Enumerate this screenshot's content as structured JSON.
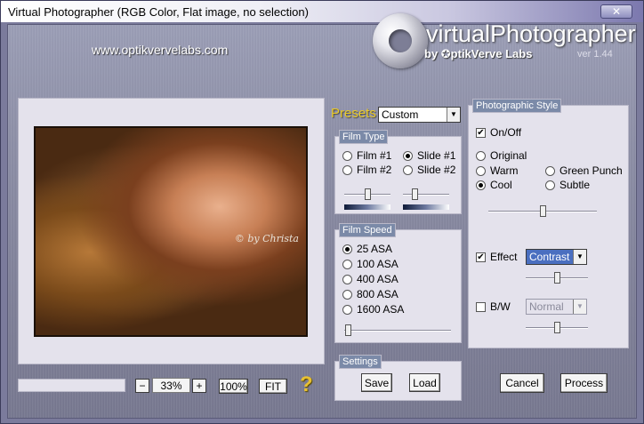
{
  "window": {
    "title": "Virtual Photographer (RGB Color, Flat image, no selection)",
    "close_glyph": "✕"
  },
  "header": {
    "url": "www.optikvervelabs.com",
    "logo_title": "virtualPhotographer",
    "logo_sub": "by ✪ptikVerve Labs",
    "version": "ver 1.44"
  },
  "preview": {
    "signature": "© by Christa"
  },
  "zoom": {
    "minus": "−",
    "value": "33%",
    "plus": "+",
    "hundred_label": "100%",
    "fit_label": "FIT",
    "help_glyph": "?"
  },
  "presets": {
    "label": "Presets",
    "selected": "Custom"
  },
  "film_type": {
    "title": "Film Type",
    "options": [
      "Film #1",
      "Slide #1",
      "Film #2",
      "Slide #2"
    ],
    "selected": "Slide #1",
    "slider_left": 0.5,
    "slider_right": 0.25
  },
  "film_speed": {
    "title": "Film Speed",
    "options": [
      "25 ASA",
      "100 ASA",
      "400 ASA",
      "800 ASA",
      "1600 ASA"
    ],
    "selected": "25 ASA",
    "slider": 0.03
  },
  "settings": {
    "title": "Settings",
    "save_label": "Save",
    "load_label": "Load"
  },
  "photographic_style": {
    "title": "Photographic Style",
    "onoff_label": "On/Off",
    "onoff_checked": true,
    "options": [
      "Original",
      "Warm",
      "Green Punch",
      "Cool",
      "Subtle"
    ],
    "selected": "Cool",
    "style_slider": 0.5,
    "effect_label": "Effect",
    "effect_checked": true,
    "effect_value": "Contrast",
    "effect_slider": 0.5,
    "bw_label": "B/W",
    "bw_checked": false,
    "bw_value": "Normal",
    "bw_slider": 0.5
  },
  "actions": {
    "cancel_label": "Cancel",
    "process_label": "Process"
  }
}
